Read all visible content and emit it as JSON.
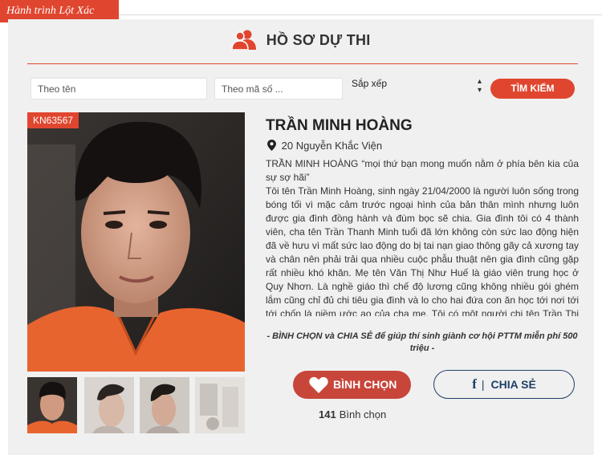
{
  "brand": {
    "label": "Hành trình Lột Xác"
  },
  "header": {
    "title": "HỒ SƠ DỰ THI"
  },
  "search": {
    "name_placeholder": "Theo tên",
    "code_placeholder": "Theo mã số ...",
    "sort_label": "Sắp xếp",
    "search_button": "TÌM KIẾM"
  },
  "profile": {
    "code": "KN63567",
    "name": "TRẦN MINH HOÀNG",
    "address": "20 Nguyễn Khắc Viện",
    "quote": "TRẦN MINH HOÀNG “mọi thứ bạn mong muốn nằm ở phía bên kia của sự sợ hãi”",
    "bio": "Tôi tên Trần Minh Hoàng, sinh ngày 21/04/2000 là người luôn sống trong bóng tối vì mặc cảm trước ngoại hình của bản thân mình nhưng luôn được gia đình đồng hành và đùm bọc sẽ chia. Gia đình tôi có 4 thành viên, cha tên Trần Thanh Minh tuổi đã lớn không còn sức lao động hiện đã về hưu vì mất sức lao động do bị tai nạn giao thông gãy cả xương tay và chân nên phải trải qua nhiều cuộc phẫu thuật nên gia đình cũng gặp rất nhiều khó khăn. Mẹ tên Văn Thị Như Huế là giáo viên trung học ở Quy Nhơn. Là nghề giáo thì chế độ lương cũng không nhiều gói ghém lắm cũng chỉ đủ chi tiêu gia đình và lo cho hai đứa con ăn học tới nơi tới tới chốn là niềm ước ao của cha mẹ. Tôi có một người chị tên Trần Thị Tuyết Trinh làm nội trợ cho gia đình vì gia đình",
    "call_to_action": "- BÌNH CHỌN và CHIA SẺ để giúp thí sinh giành cơ hội PTTM miễn phí 500 triệu -",
    "vote_button": "BÌNH CHỌN",
    "share_button": "CHIA SẺ",
    "vote_count": "141",
    "vote_label": "Bình chọn"
  },
  "colors": {
    "accent": "#e0462f",
    "vote": "#c8453a",
    "facebook": "#1e3f66",
    "panel": "#f0f0f0"
  },
  "icons": [
    "users-icon",
    "map-pin-icon",
    "heart-icon",
    "facebook-icon",
    "chevron-updown-icon"
  ]
}
